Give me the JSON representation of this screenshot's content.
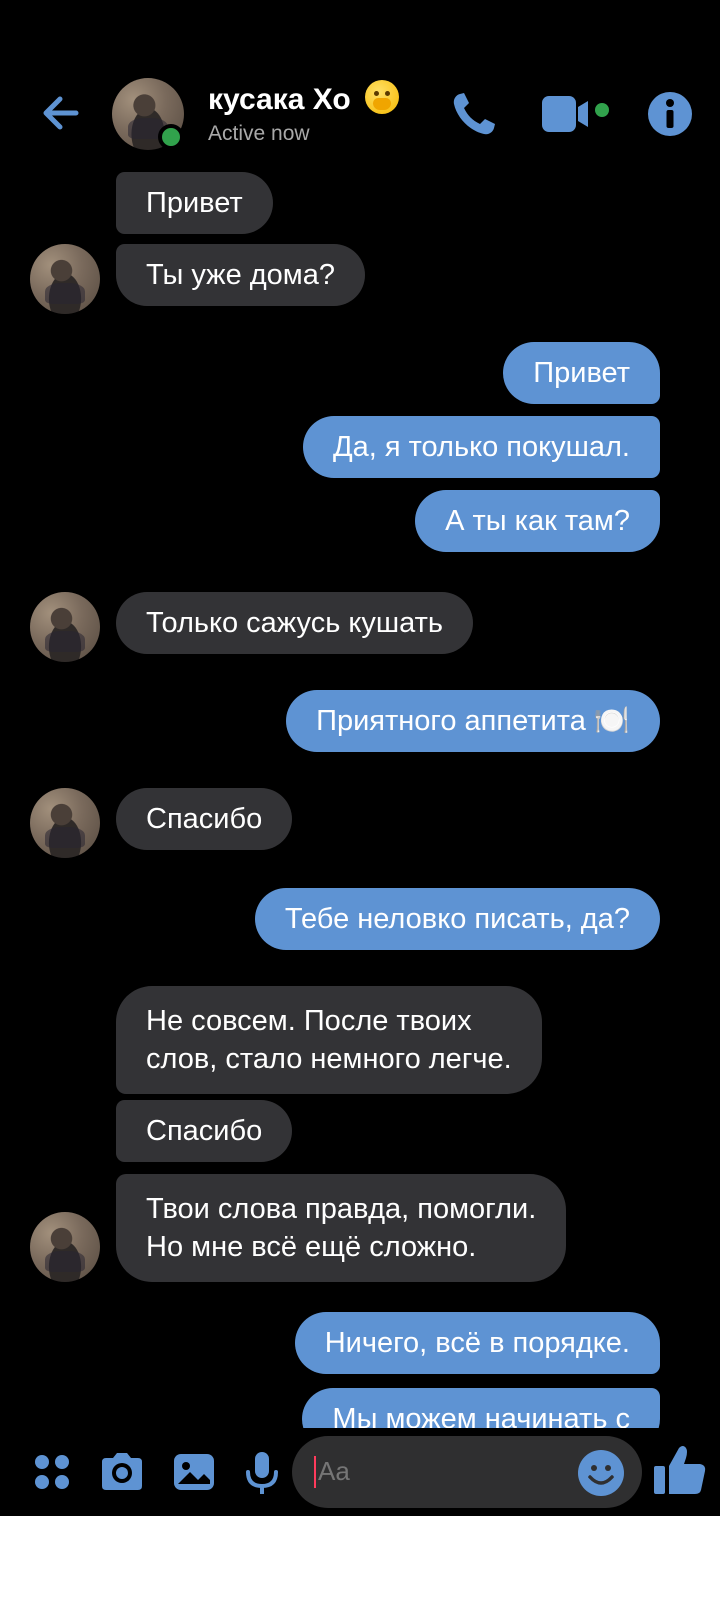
{
  "header": {
    "contact_name": "кусака Хо",
    "status": "Active now"
  },
  "colors": {
    "background": "#000000",
    "accent": "#5e93d3",
    "incoming_bubble": "#333336",
    "online": "#31a24c"
  },
  "icons": [
    "back-arrow-icon",
    "phone-icon",
    "video-camera-icon",
    "info-icon",
    "apps-icon",
    "camera-icon",
    "gallery-icon",
    "microphone-icon",
    "emoji-icon",
    "thumbs-up-icon"
  ],
  "messages": [
    {
      "from": "them",
      "text": "Привет"
    },
    {
      "from": "them",
      "text": "Ты уже дома?"
    },
    {
      "from": "me",
      "text": "Привет"
    },
    {
      "from": "me",
      "text": "Да, я только покушал."
    },
    {
      "from": "me",
      "text": "А ты как там?"
    },
    {
      "from": "them",
      "text": "Только сажусь кушать"
    },
    {
      "from": "me",
      "text": "Приятного аппетита 🍽️"
    },
    {
      "from": "them",
      "text": "Спасибо"
    },
    {
      "from": "me",
      "text": "Тебе неловко писать, да?"
    },
    {
      "from": "them",
      "text": "Не совсем. После твоих\nслов, стало немного легче."
    },
    {
      "from": "them",
      "text": "Спасибо"
    },
    {
      "from": "them",
      "text": "Твои слова правда, помогли.\nНо мне всё ещё сложно."
    },
    {
      "from": "me",
      "text": "Ничего, всё в порядке."
    },
    {
      "from": "me",
      "text": "Мы можем начинать с"
    }
  ],
  "composer": {
    "placeholder": "Aa"
  }
}
